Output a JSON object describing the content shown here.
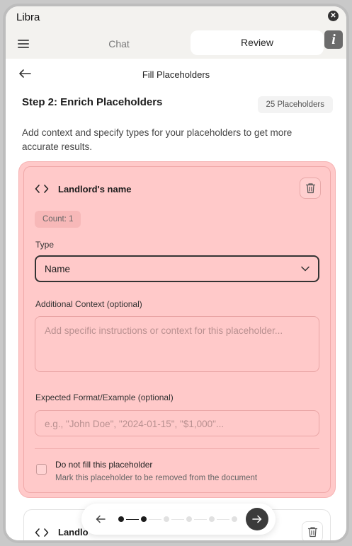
{
  "window": {
    "title": "Libra"
  },
  "tabs": {
    "chat": "Chat",
    "review": "Review"
  },
  "header": {
    "title": "Fill Placeholders"
  },
  "step": {
    "title": "Step 2: Enrich Placeholders",
    "count_badge": "25 Placeholders",
    "description": "Add context and specify types for your placeholders to get more accurate results."
  },
  "placeholder_card": {
    "name": "Landlord's name",
    "count": "Count: 1",
    "type_label": "Type",
    "type_value": "Name",
    "context_label": "Additional Context (optional)",
    "context_placeholder": "Add specific instructions or context for this placeholder...",
    "format_label": "Expected Format/Example (optional)",
    "format_placeholder": "e.g., \"John Doe\", \"2024-01-15\", \"$1,000\"...",
    "skip_label": "Do not fill this placeholder",
    "skip_help": "Mark this placeholder to be removed from the document"
  },
  "next_card": {
    "name_visible": "Landlo"
  },
  "stepper": {
    "total_steps": 6,
    "current_step": 2
  },
  "colors": {
    "highlight": "#ffc9c9",
    "dark": "#1c1c1c"
  }
}
